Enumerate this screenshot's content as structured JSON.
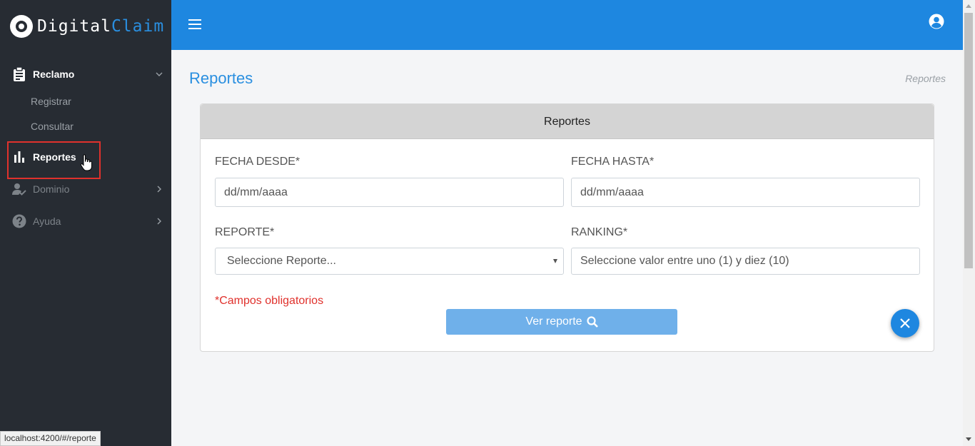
{
  "brand": {
    "name_white": "Digital",
    "name_blue": "Claim",
    "colors": {
      "white": "#ffffff",
      "accent": "#2a8fe0"
    }
  },
  "sidebar": {
    "items": [
      {
        "label": "Reclamo",
        "icon": "clipboard-icon",
        "expanded": true,
        "children": [
          {
            "label": "Registrar"
          },
          {
            "label": "Consultar"
          }
        ]
      },
      {
        "label": "Reportes",
        "icon": "bar-chart-icon",
        "active": true
      },
      {
        "label": "Dominio",
        "icon": "user-check-icon"
      },
      {
        "label": "Ayuda",
        "icon": "help-circle-icon"
      }
    ]
  },
  "statusbar": {
    "url": "localhost:4200/#/reporte"
  },
  "topbar": {
    "menu_icon": "hamburger-icon",
    "user_icon": "user-circle-icon",
    "color": "#1e87e0"
  },
  "page": {
    "title": "Reportes",
    "breadcrumb": "Reportes"
  },
  "card": {
    "header": "Reportes",
    "fields": {
      "fecha_desde": {
        "label": "FECHA DESDE*",
        "placeholder": "dd/mm/aaaa"
      },
      "fecha_hasta": {
        "label": "FECHA HASTA*",
        "placeholder": "dd/mm/aaaa"
      },
      "reporte": {
        "label": "REPORTE*",
        "selected": "Seleccione Reporte..."
      },
      "ranking": {
        "label": "RANKING*",
        "placeholder": "Seleccione valor entre uno (1) y diez (10)"
      }
    },
    "required_note": "*Campos obligatorios",
    "submit_label": "Ver reporte",
    "submit_icon": "search-icon",
    "close_icon": "close-icon"
  }
}
